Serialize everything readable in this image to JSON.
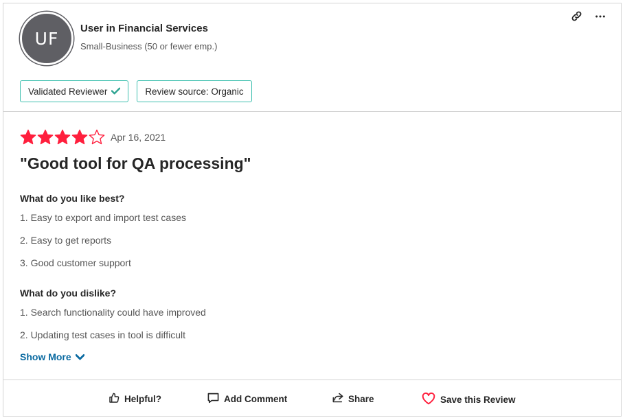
{
  "reviewer": {
    "initials": "UF",
    "name": "User in Financial Services",
    "company_size": "Small-Business (50 or fewer emp.)"
  },
  "top_icons": [
    "link-icon",
    "more-options-icon"
  ],
  "badges": {
    "validated": "Validated Reviewer",
    "source": "Review source: Organic"
  },
  "review": {
    "rating": 4,
    "max_rating": 5,
    "date": "Apr 16, 2021",
    "title": "\"Good tool for QA processing\"",
    "like_question": "What do you like best?",
    "likes": [
      "1. Easy to export and import test cases",
      "2. Easy to get reports",
      "3. Good customer support"
    ],
    "dislike_question": "What do you dislike?",
    "dislikes": [
      "1. Search functionality could have improved",
      "2. Updating test cases in tool is difficult"
    ],
    "show_more": "Show More"
  },
  "actions": {
    "helpful": "Helpful?",
    "comment": "Add Comment",
    "share": "Share",
    "save": "Save this Review"
  },
  "colors": {
    "star": "#ff1f3d",
    "badge_border": "#3cbfae",
    "link": "#0a6aa1",
    "heart": "#ff1f3d"
  }
}
